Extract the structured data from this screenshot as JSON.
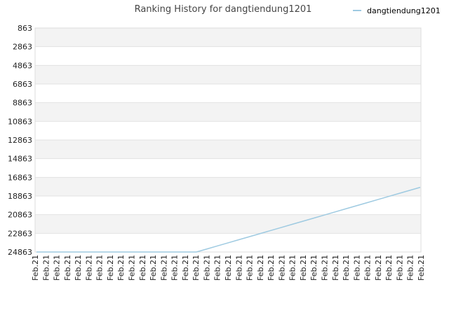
{
  "chart_data": {
    "type": "line",
    "title": "Ranking History for dangtiendung1201",
    "xlabel": "",
    "ylabel": "",
    "y_inverted": true,
    "ylim": [
      863,
      24863
    ],
    "y_ticks": [
      863,
      2863,
      4863,
      6863,
      8863,
      10863,
      12863,
      14863,
      16863,
      18863,
      20863,
      22863,
      24863
    ],
    "legend_position": "top-right",
    "x_labels": [
      "Feb.21",
      "Feb.21",
      "Feb.21",
      "Feb.21",
      "Feb.21",
      "Feb.21",
      "Feb.21",
      "Feb.21",
      "Feb.21",
      "Feb.21",
      "Feb.21",
      "Feb.21",
      "Feb.21",
      "Feb.21",
      "Feb.21",
      "Feb.21",
      "Feb.21",
      "Feb.21",
      "Feb.21",
      "Feb.21",
      "Feb.21",
      "Feb.21",
      "Feb.21",
      "Feb.21",
      "Feb.21",
      "Feb.21",
      "Feb.21",
      "Feb.21",
      "Feb.21",
      "Feb.21",
      "Feb.21",
      "Feb.21",
      "Feb.21",
      "Feb.21",
      "Feb.21",
      "Feb.21",
      "Feb.21"
    ],
    "series": [
      {
        "name": "dangtiendung1201",
        "color": "#9ecae1",
        "values": [
          24863,
          24863,
          24863,
          24863,
          24863,
          24863,
          24863,
          24863,
          24863,
          24863,
          24863,
          24863,
          24863,
          24863,
          24863,
          24863,
          24530,
          24200,
          23870,
          23540,
          23210,
          22880,
          22550,
          22220,
          21890,
          21560,
          21230,
          20900,
          20570,
          20240,
          19910,
          19580,
          19250,
          18920,
          18590,
          18260,
          17930
        ]
      }
    ]
  }
}
